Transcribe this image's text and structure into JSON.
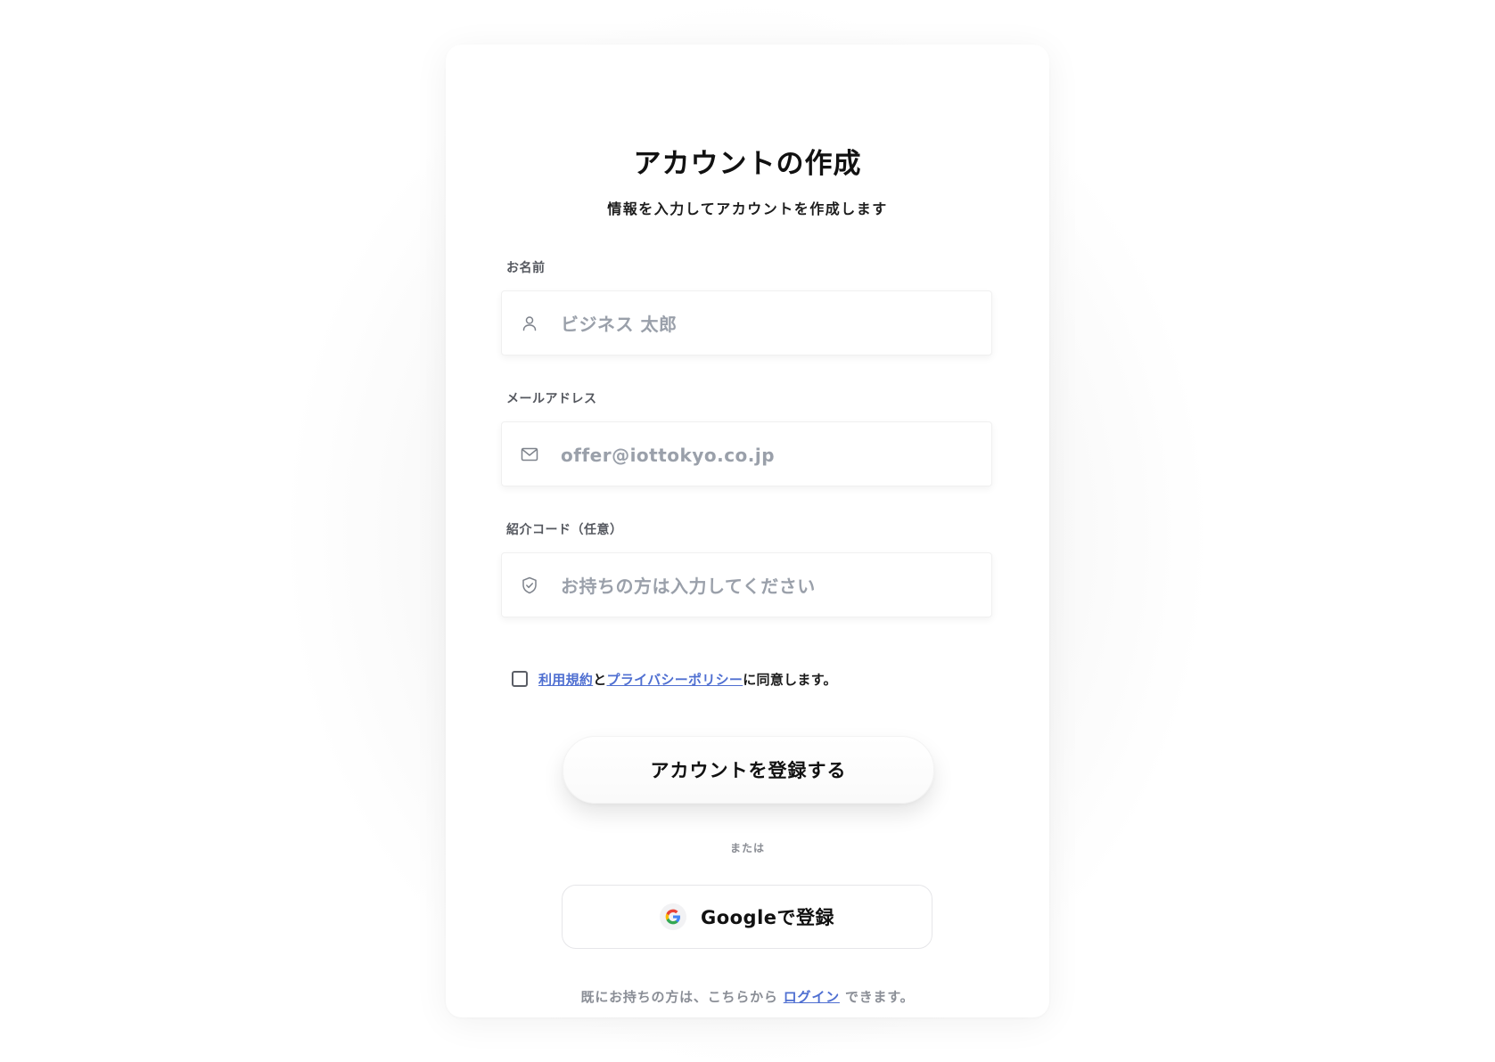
{
  "header": {
    "title": "アカウントの作成",
    "subtitle": "情報を入力してアカウントを作成します"
  },
  "form": {
    "name": {
      "label": "お名前",
      "placeholder": "ビジネス 太郎",
      "value": "",
      "icon": "user-icon"
    },
    "email": {
      "label": "メールアドレス",
      "placeholder": "offer@iottokyo.co.jp",
      "value": "",
      "icon": "mail-icon"
    },
    "referral": {
      "label": "紹介コード（任意）",
      "placeholder": "お持ちの方は入力してください",
      "value": "",
      "icon": "shield-check-icon"
    },
    "agreement": {
      "checked": false,
      "terms_link": "利用規約",
      "connector": "と",
      "privacy_link": "プライバシーポリシー",
      "suffix": "に同意します。"
    }
  },
  "actions": {
    "register_label": "アカウントを登録する",
    "divider_text": "または",
    "google_label": "Googleで登録",
    "google_icon": "google-g-icon"
  },
  "footer": {
    "prefix": "既にお持ちの方は、こちらから",
    "login_link": "ログイン",
    "suffix": "できます。"
  },
  "colors": {
    "link": "#4f6fd1",
    "placeholder": "#9aa0aa",
    "muted_text": "#8a8e96"
  }
}
